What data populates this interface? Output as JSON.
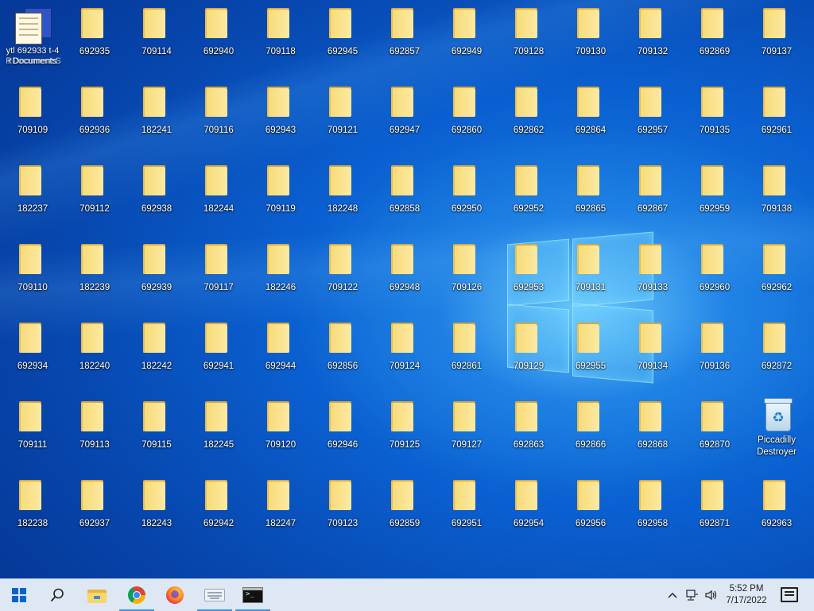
{
  "desktop": {
    "special": {
      "doc_app": {
        "label_line1": "ytl 692933 t-4",
        "label_line2": "r Documents",
        "overlap_line1": "RDocuments",
        "overlap_line2": "S"
      },
      "recycle_bin": {
        "label": "Piccadilly Destroyer"
      }
    },
    "folders": [
      "692935",
      "709114",
      "692940",
      "709118",
      "692945",
      "692857",
      "692949",
      "709128",
      "709130",
      "709132",
      "692869",
      "709137",
      "709109",
      "692936",
      "182241",
      "709116",
      "692943",
      "709121",
      "692947",
      "692860",
      "692862",
      "692864",
      "692957",
      "709135",
      "692961",
      "182237",
      "709112",
      "692938",
      "182244",
      "709119",
      "182248",
      "692858",
      "692950",
      "692952",
      "692865",
      "692867",
      "692959",
      "709138",
      "709110",
      "182239",
      "692939",
      "709117",
      "182246",
      "709122",
      "692948",
      "709126",
      "692953",
      "709131",
      "709133",
      "692960",
      "692962",
      "692934",
      "182240",
      "182242",
      "692941",
      "692944",
      "692856",
      "709124",
      "692861",
      "709129",
      "692955",
      "709134",
      "709136",
      "692872",
      "709111",
      "709113",
      "709115",
      "182245",
      "709120",
      "692946",
      "709125",
      "709127",
      "692863",
      "692866",
      "692868",
      "692870",
      "182238",
      "692937",
      "182243",
      "692942",
      "182247",
      "709123",
      "692859",
      "692951",
      "692954",
      "692956",
      "692958",
      "692871",
      "692963"
    ]
  },
  "taskbar": {
    "clock": {
      "time": "5:52 PM",
      "date": "7/17/2022"
    },
    "tray_icons": [
      "chevron-up-icon",
      "network-icon",
      "volume-icon"
    ]
  }
}
